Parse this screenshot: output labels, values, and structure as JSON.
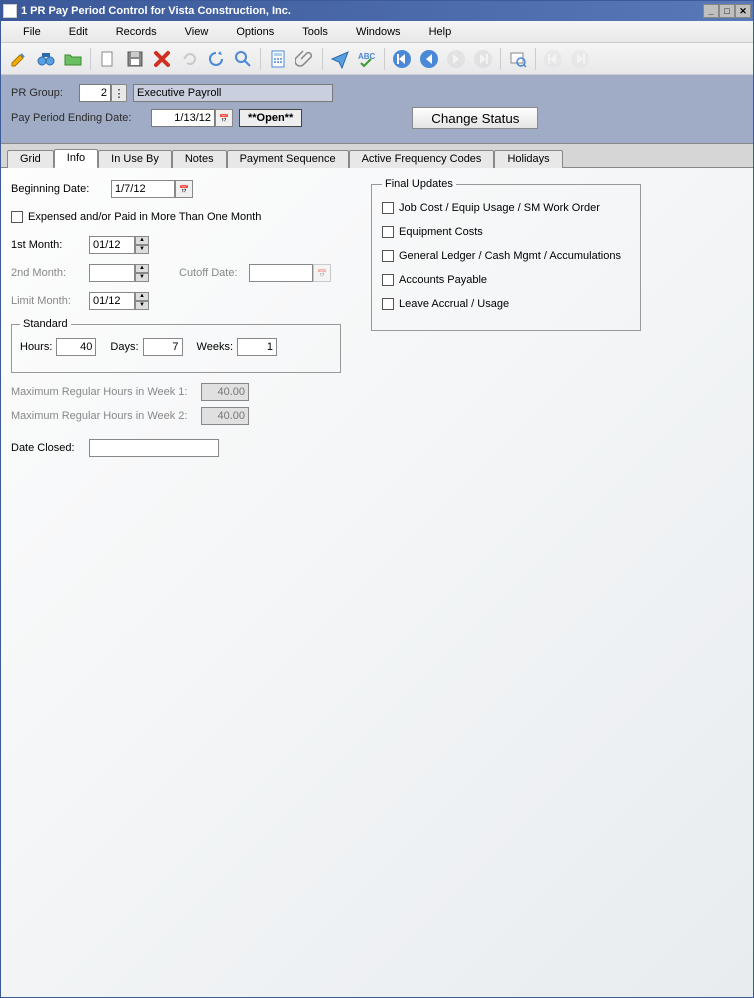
{
  "title": "1 PR Pay Period Control for Vista Construction, Inc.",
  "menu": {
    "file": "File",
    "edit": "Edit",
    "records": "Records",
    "view": "View",
    "options": "Options",
    "tools": "Tools",
    "windows": "Windows",
    "help": "Help"
  },
  "header": {
    "prgroup_label": "PR Group:",
    "prgroup_value": "2",
    "prgroup_desc": "Executive Payroll",
    "payperiod_label": "Pay Period Ending Date:",
    "payperiod_value": "1/13/12",
    "status_text": "**Open**",
    "change_status": "Change Status"
  },
  "tabs": [
    "Grid",
    "Info",
    "In Use By",
    "Notes",
    "Payment Sequence",
    "Active Frequency Codes",
    "Holidays"
  ],
  "info": {
    "beginning_label": "Beginning Date:",
    "beginning_value": "1/7/12",
    "expensed_label": "Expensed and/or Paid in More Than One Month",
    "month1_label": "1st Month:",
    "month1_value": "01/12",
    "month2_label": "2nd Month:",
    "month2_value": "",
    "cutoff_label": "Cutoff Date:",
    "cutoff_value": "",
    "limit_label": "Limit Month:",
    "limit_value": "01/12",
    "standard": {
      "legend": "Standard",
      "hours_label": "Hours:",
      "hours_value": "40",
      "days_label": "Days:",
      "days_value": "7",
      "weeks_label": "Weeks:",
      "weeks_value": "1"
    },
    "max1_label": "Maximum Regular Hours in Week 1:",
    "max1_value": "40.00",
    "max2_label": "Maximum Regular Hours in Week 2:",
    "max2_value": "40.00",
    "closed_label": "Date Closed:",
    "closed_value": ""
  },
  "final_updates": {
    "legend": "Final Updates",
    "items": [
      "Job Cost / Equip Usage / SM Work Order",
      "Equipment Costs",
      "General Ledger / Cash Mgmt / Accumulations",
      "Accounts Payable",
      "Leave Accrual / Usage"
    ]
  }
}
